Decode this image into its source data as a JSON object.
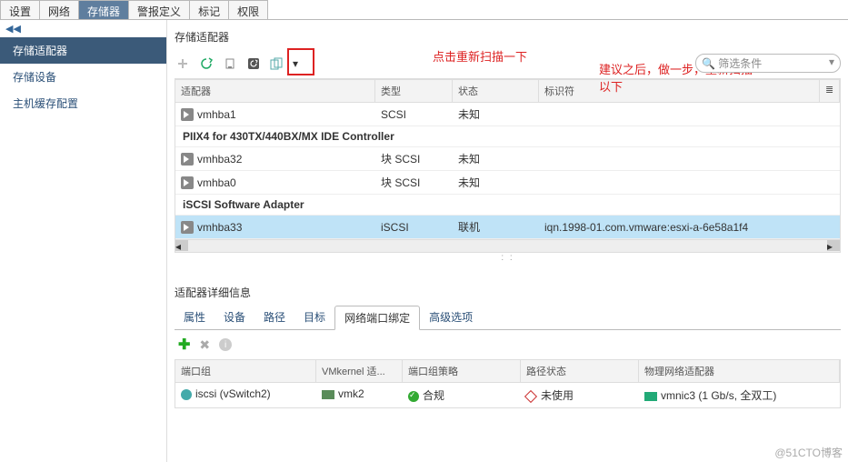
{
  "top_tabs": [
    "设置",
    "网络",
    "存储器",
    "警报定义",
    "标记",
    "权限"
  ],
  "top_tabs_active": 2,
  "sidebar_collapse": "◀◀",
  "sidebar": {
    "items": [
      "存储适配器",
      "存储设备",
      "主机缓存配置"
    ],
    "active": 0
  },
  "annotations": {
    "rescan": "点击重新扫描一下",
    "advice": "建议之后，做一步，重新扫描\n以下"
  },
  "main": {
    "title": "存储适配器",
    "filter_placeholder": "筛选条件",
    "columns": [
      "适配器",
      "类型",
      "状态",
      "标识符"
    ],
    "groups": [
      {
        "rows": [
          {
            "name": "vmhba1",
            "type": "SCSI",
            "status": "未知",
            "id": ""
          }
        ]
      },
      {
        "title": "PIIX4 for 430TX/440BX/MX IDE Controller",
        "rows": [
          {
            "name": "vmhba32",
            "type": "块 SCSI",
            "status": "未知",
            "id": ""
          },
          {
            "name": "vmhba0",
            "type": "块 SCSI",
            "status": "未知",
            "id": ""
          }
        ]
      },
      {
        "title": "iSCSI Software Adapter",
        "rows": [
          {
            "name": "vmhba33",
            "type": "iSCSI",
            "status": "联机",
            "id": "iqn.1998-01.com.vmware:esxi-a-6e58a1f4",
            "selected": true
          }
        ]
      }
    ]
  },
  "details": {
    "title": "适配器详细信息",
    "tabs": [
      "属性",
      "设备",
      "路径",
      "目标",
      "网络端口绑定",
      "高级选项"
    ],
    "active": 4,
    "bind_columns": [
      "端口组",
      "VMkernel 适...",
      "端口组策略",
      "路径状态",
      "物理网络适配器"
    ],
    "bind_row": {
      "portgroup": "iscsi (vSwitch2)",
      "vmkernel": "vmk2",
      "policy": "合规",
      "path": "未使用",
      "nic": "vmnic3 (1 Gb/s, 全双工)"
    }
  },
  "watermark": "@51CTO博客",
  "icons": {
    "search": "🔍"
  }
}
